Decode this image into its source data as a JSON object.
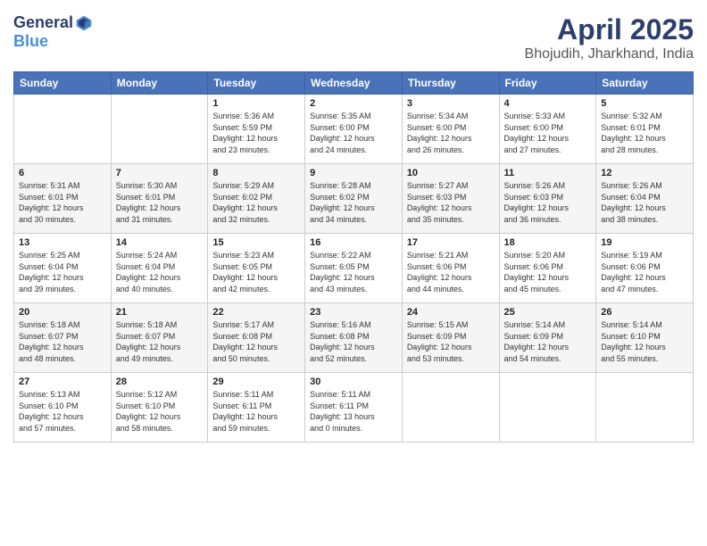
{
  "header": {
    "logo": {
      "general": "General",
      "blue": "Blue",
      "tagline": ""
    },
    "title": "April 2025",
    "location": "Bhojudih, Jharkhand, India"
  },
  "weekdays": [
    "Sunday",
    "Monday",
    "Tuesday",
    "Wednesday",
    "Thursday",
    "Friday",
    "Saturday"
  ],
  "weeks": [
    [
      null,
      null,
      {
        "day": 1,
        "sunrise": "5:36 AM",
        "sunset": "5:59 PM",
        "daylight": "12 hours and 23 minutes."
      },
      {
        "day": 2,
        "sunrise": "5:35 AM",
        "sunset": "6:00 PM",
        "daylight": "12 hours and 24 minutes."
      },
      {
        "day": 3,
        "sunrise": "5:34 AM",
        "sunset": "6:00 PM",
        "daylight": "12 hours and 26 minutes."
      },
      {
        "day": 4,
        "sunrise": "5:33 AM",
        "sunset": "6:00 PM",
        "daylight": "12 hours and 27 minutes."
      },
      {
        "day": 5,
        "sunrise": "5:32 AM",
        "sunset": "6:01 PM",
        "daylight": "12 hours and 28 minutes."
      }
    ],
    [
      {
        "day": 6,
        "sunrise": "5:31 AM",
        "sunset": "6:01 PM",
        "daylight": "12 hours and 30 minutes."
      },
      {
        "day": 7,
        "sunrise": "5:30 AM",
        "sunset": "6:01 PM",
        "daylight": "12 hours and 31 minutes."
      },
      {
        "day": 8,
        "sunrise": "5:29 AM",
        "sunset": "6:02 PM",
        "daylight": "12 hours and 32 minutes."
      },
      {
        "day": 9,
        "sunrise": "5:28 AM",
        "sunset": "6:02 PM",
        "daylight": "12 hours and 34 minutes."
      },
      {
        "day": 10,
        "sunrise": "5:27 AM",
        "sunset": "6:03 PM",
        "daylight": "12 hours and 35 minutes."
      },
      {
        "day": 11,
        "sunrise": "5:26 AM",
        "sunset": "6:03 PM",
        "daylight": "12 hours and 36 minutes."
      },
      {
        "day": 12,
        "sunrise": "5:26 AM",
        "sunset": "6:04 PM",
        "daylight": "12 hours and 38 minutes."
      }
    ],
    [
      {
        "day": 13,
        "sunrise": "5:25 AM",
        "sunset": "6:04 PM",
        "daylight": "12 hours and 39 minutes."
      },
      {
        "day": 14,
        "sunrise": "5:24 AM",
        "sunset": "6:04 PM",
        "daylight": "12 hours and 40 minutes."
      },
      {
        "day": 15,
        "sunrise": "5:23 AM",
        "sunset": "6:05 PM",
        "daylight": "12 hours and 42 minutes."
      },
      {
        "day": 16,
        "sunrise": "5:22 AM",
        "sunset": "6:05 PM",
        "daylight": "12 hours and 43 minutes."
      },
      {
        "day": 17,
        "sunrise": "5:21 AM",
        "sunset": "6:06 PM",
        "daylight": "12 hours and 44 minutes."
      },
      {
        "day": 18,
        "sunrise": "5:20 AM",
        "sunset": "6:06 PM",
        "daylight": "12 hours and 45 minutes."
      },
      {
        "day": 19,
        "sunrise": "5:19 AM",
        "sunset": "6:06 PM",
        "daylight": "12 hours and 47 minutes."
      }
    ],
    [
      {
        "day": 20,
        "sunrise": "5:18 AM",
        "sunset": "6:07 PM",
        "daylight": "12 hours and 48 minutes."
      },
      {
        "day": 21,
        "sunrise": "5:18 AM",
        "sunset": "6:07 PM",
        "daylight": "12 hours and 49 minutes."
      },
      {
        "day": 22,
        "sunrise": "5:17 AM",
        "sunset": "6:08 PM",
        "daylight": "12 hours and 50 minutes."
      },
      {
        "day": 23,
        "sunrise": "5:16 AM",
        "sunset": "6:08 PM",
        "daylight": "12 hours and 52 minutes."
      },
      {
        "day": 24,
        "sunrise": "5:15 AM",
        "sunset": "6:09 PM",
        "daylight": "12 hours and 53 minutes."
      },
      {
        "day": 25,
        "sunrise": "5:14 AM",
        "sunset": "6:09 PM",
        "daylight": "12 hours and 54 minutes."
      },
      {
        "day": 26,
        "sunrise": "5:14 AM",
        "sunset": "6:10 PM",
        "daylight": "12 hours and 55 minutes."
      }
    ],
    [
      {
        "day": 27,
        "sunrise": "5:13 AM",
        "sunset": "6:10 PM",
        "daylight": "12 hours and 57 minutes."
      },
      {
        "day": 28,
        "sunrise": "5:12 AM",
        "sunset": "6:10 PM",
        "daylight": "12 hours and 58 minutes."
      },
      {
        "day": 29,
        "sunrise": "5:11 AM",
        "sunset": "6:11 PM",
        "daylight": "12 hours and 59 minutes."
      },
      {
        "day": 30,
        "sunrise": "5:11 AM",
        "sunset": "6:11 PM",
        "daylight": "13 hours and 0 minutes."
      },
      null,
      null,
      null
    ]
  ],
  "labels": {
    "sunrise": "Sunrise:",
    "sunset": "Sunset:",
    "daylight": "Daylight:"
  }
}
